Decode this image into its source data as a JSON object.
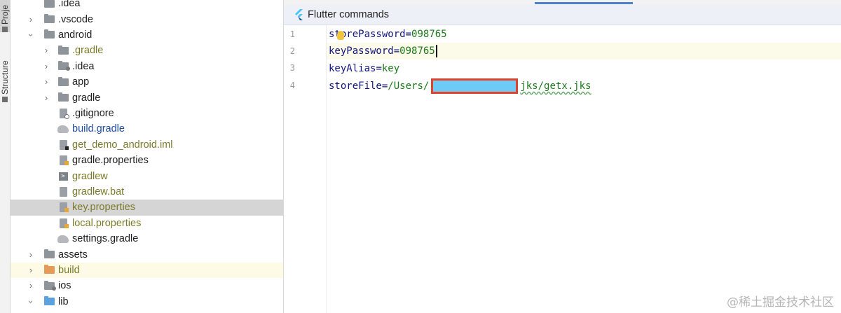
{
  "sidebar": {
    "project_tab": "Proje",
    "structure_tab": "Structure"
  },
  "tree": {
    "items": [
      {
        "label": ".idea",
        "icon": "folder-settings-icon"
      },
      {
        "label": ".vscode",
        "icon": "folder-icon"
      },
      {
        "label": "android",
        "icon": "folder-icon"
      },
      {
        "label": ".gradle",
        "icon": "folder-icon"
      },
      {
        "label": ".idea",
        "icon": "folder-settings-icon"
      },
      {
        "label": "app",
        "icon": "folder-icon"
      },
      {
        "label": "gradle",
        "icon": "folder-icon"
      },
      {
        "label": ".gitignore",
        "icon": "gitignore-file-icon"
      },
      {
        "label": "build.gradle",
        "icon": "gradle-elephant-icon"
      },
      {
        "label": "get_demo_android.iml",
        "icon": "iml-file-icon"
      },
      {
        "label": "gradle.properties",
        "icon": "properties-file-icon"
      },
      {
        "label": "gradlew",
        "icon": "shell-script-icon"
      },
      {
        "label": "gradlew.bat",
        "icon": "bat-file-icon"
      },
      {
        "label": "key.properties",
        "icon": "properties-file-icon"
      },
      {
        "label": "local.properties",
        "icon": "properties-file-icon"
      },
      {
        "label": "settings.gradle",
        "icon": "gradle-elephant-icon"
      },
      {
        "label": "assets",
        "icon": "folder-icon"
      },
      {
        "label": "build",
        "icon": "folder-excluded-icon"
      },
      {
        "label": "ios",
        "icon": "folder-settings-icon"
      },
      {
        "label": "lib",
        "icon": "folder-source-icon"
      }
    ]
  },
  "editor": {
    "banner": "Flutter commands",
    "lines": [
      {
        "number": "1",
        "key": "storePassword",
        "eq": "=",
        "value": "098765"
      },
      {
        "number": "2",
        "key": "keyPassword",
        "eq": "=",
        "value": "098765"
      },
      {
        "number": "3",
        "key": "keyAlias",
        "eq": "=",
        "value": "key"
      },
      {
        "number": "4",
        "key": "storeFile",
        "eq": "=",
        "value_prefix": "/Users/",
        "value_suffix": "jks/getx.jks"
      }
    ]
  },
  "watermark": "@稀土掘金技术社区",
  "colors": {
    "key": "#11147f",
    "value": "#1a7a1a",
    "selection": "#d5d5d5",
    "current_line": "#fcfae8",
    "redaction_fill": "#6ecbf6",
    "redaction_border": "#e0422b"
  }
}
